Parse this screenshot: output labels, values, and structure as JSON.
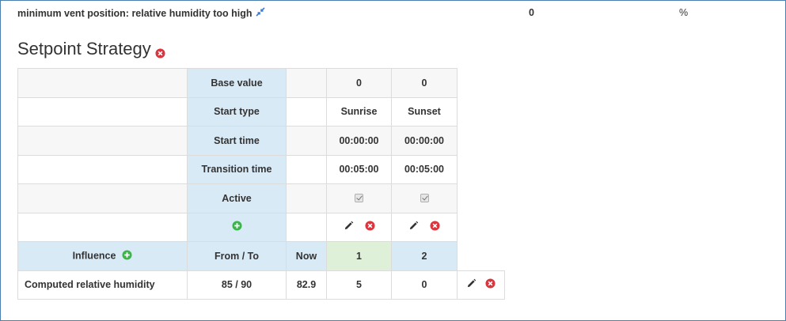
{
  "top_row": {
    "label": "minimum vent position: relative humidity too high",
    "value": "0",
    "unit": "%"
  },
  "section": {
    "title": "Setpoint Strategy"
  },
  "rows": {
    "base_value": {
      "label": "Base value",
      "v1": "0",
      "v2": "0"
    },
    "start_type": {
      "label": "Start type",
      "v1": "Sunrise",
      "v2": "Sunset"
    },
    "start_time": {
      "label": "Start time",
      "v1": "00:00:00",
      "v2": "00:00:00"
    },
    "transition_time": {
      "label": "Transition time",
      "v1": "00:05:00",
      "v2": "00:05:00"
    },
    "active": {
      "label": "Active",
      "v1": true,
      "v2": true
    }
  },
  "header": {
    "influence": "Influence",
    "from_to": "From / To",
    "now": "Now",
    "col1": "1",
    "col2": "2"
  },
  "influence_row": {
    "name": "Computed relative humidity",
    "from_to": "85 / 90",
    "now": "82.9",
    "v1": "5",
    "v2": "0"
  },
  "colors": {
    "delete": "#d9363e",
    "add": "#3cb44b",
    "header_bg": "#d9eaf7",
    "active_col_bg": "#dff0d8",
    "accent": "#3a7bd5"
  }
}
